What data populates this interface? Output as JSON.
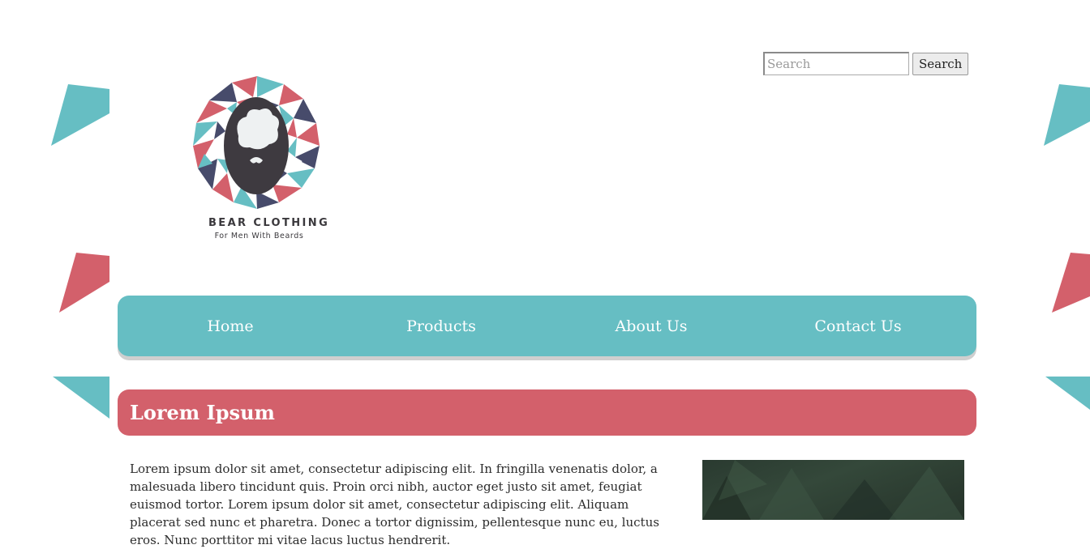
{
  "colors": {
    "teal": "#66bec3",
    "coral": "#d3606b",
    "navy": "#474b6b",
    "dark": "#3a383c"
  },
  "search": {
    "placeholder": "Search",
    "value": "",
    "button_label": "Search"
  },
  "logo": {
    "title": "BEAR CLOTHING",
    "subtitle": "For Men With Beards"
  },
  "nav": {
    "items": [
      {
        "label": "Home"
      },
      {
        "label": "Products"
      },
      {
        "label": "About Us"
      },
      {
        "label": "Contact Us"
      }
    ]
  },
  "section": {
    "title": "Lorem Ipsum",
    "body": "Lorem ipsum dolor sit amet, consectetur adipiscing elit. In fringilla venenatis dolor, a malesuada libero tincidunt quis. Proin orci nibh, auctor eget justo sit amet, feugiat euismod tortor. Lorem ipsum dolor sit amet, consectetur adipiscing elit. Aliquam placerat sed nunc et pharetra. Donec a tortor dignissim, pellentesque nunc eu, luctus eros. Nunc porttitor mi vitae lacus luctus hendrerit."
  }
}
